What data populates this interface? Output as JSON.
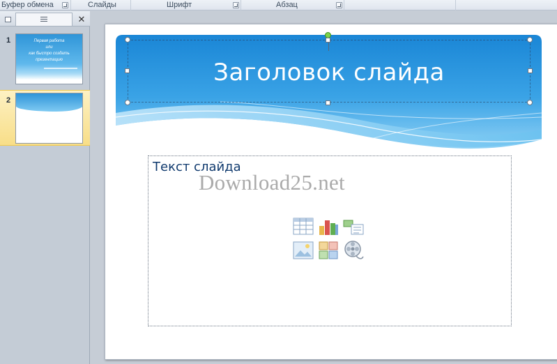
{
  "ribbon": {
    "groups": [
      {
        "label": "Буфер обмена",
        "launcher": true
      },
      {
        "label": "Слайды",
        "launcher": false
      },
      {
        "label": "Шрифт",
        "launcher": true
      },
      {
        "label": "Абзац",
        "launcher": true
      }
    ]
  },
  "pane": {
    "tabs": {
      "outline_icon": "outline-icon",
      "slides_icon": "slides-list-icon",
      "close": "✕"
    },
    "slides": [
      {
        "number": "1",
        "title_lines": [
          "Первая работа",
          "или",
          "как быстро создать",
          "презентацию"
        ],
        "selected": false
      },
      {
        "number": "2",
        "selected": true
      }
    ]
  },
  "slide": {
    "title": "Заголовок слайда",
    "body_placeholder": "Текст слайда",
    "watermark": "Download25.net",
    "content_icons": [
      "insert-table-icon",
      "insert-chart-icon",
      "insert-smartart-icon",
      "insert-picture-icon",
      "insert-clipart-icon",
      "insert-media-icon"
    ]
  },
  "colors": {
    "title_band_top": "#1a86d6",
    "title_band_bottom": "#5fbbef",
    "body_text": "#103a6e",
    "selection": "#f8de88"
  }
}
